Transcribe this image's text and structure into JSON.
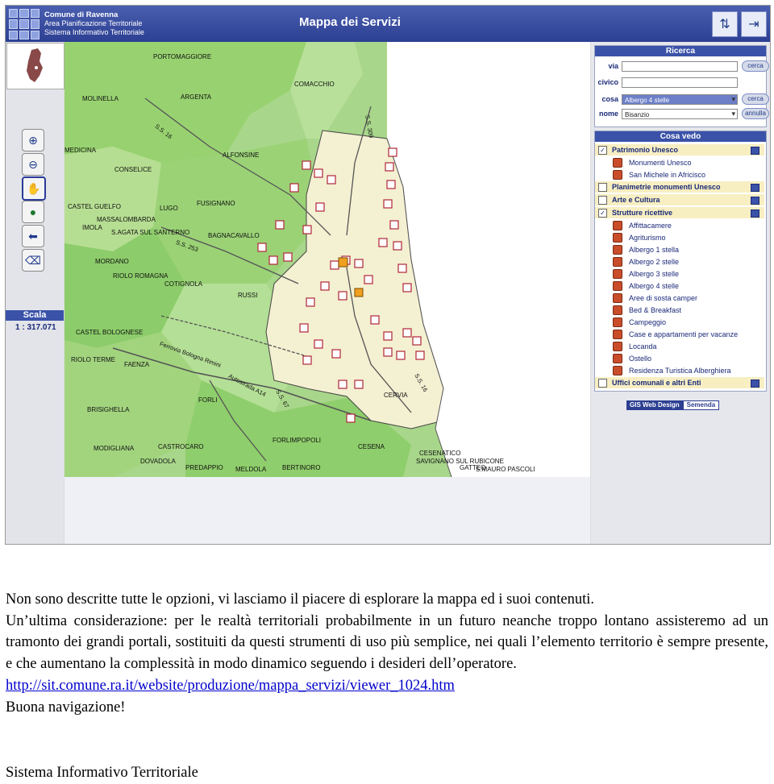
{
  "header": {
    "org_line1": "Comune di Ravenna",
    "org_line2": "Area Pianificazione Territoriale",
    "org_line3": "Sistema Informativo Territoriale",
    "title": "Mappa dei Servizi"
  },
  "toolbar": {
    "tools": [
      "zoom-in-icon",
      "zoom-out-icon",
      "pan-hand-icon",
      "globe-icon",
      "back-arrow-icon",
      "eraser-icon"
    ]
  },
  "scale": {
    "label": "Scala",
    "value": "1 : 317.071"
  },
  "map_labels": [
    "PORTOMAGGIORE",
    "COMACCHIO",
    "MOLINELLA",
    "ARGENTA",
    "MEDICINA",
    "ALFONSINE",
    "CONSELICE",
    "CASTEL GUELFO",
    "MASSALOMBARDA",
    "LUGO",
    "FUSIGNANO",
    "IMOLA",
    "S.AGATA SUL SANTERNO",
    "BAGNACAVALLO",
    "MORDANO",
    "RIOLO ROMAGNA",
    "COTIGNOLA",
    "RUSSI",
    "CASTEL BOLOGNESE",
    "RIOLO TERME",
    "FAENZA",
    "FORLI",
    "BRISIGHELLA",
    "CERVIA",
    "MODIGLIANA",
    "CASTROCARO",
    "FORLIMPOPOLI",
    "DOVADOLA",
    "CESENA",
    "PREDAPPIO",
    "MELDOLA",
    "BERTINORO",
    "CESENATICO",
    "SAVIGNANO SUL RUBICONE",
    "GATTEO",
    "S.MAURO PASCOLI"
  ],
  "road_labels": [
    "S.S. 16",
    "S.S. 309",
    "S.S. 253",
    "Autostrada A14",
    "Ferrovia Bologna Rimini",
    "S.S. 67",
    "S.S. 16"
  ],
  "search": {
    "title": "Ricerca",
    "via_label": "via",
    "civico_label": "civico",
    "cosa_label": "cosa",
    "nome_label": "nome",
    "cosa_value": "Albergo 4 stelle",
    "nome_value": "Bisanzio",
    "cerca_label": "cerca",
    "annulla_label": "annulla"
  },
  "cosa_vedo": {
    "title": "Cosa vedo",
    "categories": [
      {
        "label": "Patrimonio Unesco",
        "checked": "✓"
      },
      {
        "label": "Planimetrie monumenti Unesco",
        "checked": ""
      },
      {
        "label": "Arte e Cultura",
        "checked": ""
      },
      {
        "label": "Strutture ricettive",
        "checked": "✓"
      },
      {
        "label": "Uffici comunali e altri Enti",
        "checked": ""
      }
    ],
    "unesco_items": [
      "Monumenti Unesco",
      "San Michele in Africisco"
    ],
    "ricettive_items": [
      "Affittacamere",
      "Agriturismo",
      "Albergo 1 stella",
      "Albergo 2 stelle",
      "Albergo 3 stelle",
      "Albergo 4 stelle",
      "Aree di sosta camper",
      "Bed & Breakfast",
      "Campeggio",
      "Case e appartamenti per vacanze",
      "Locanda",
      "Ostello",
      "Residenza Turistica Alberghiera"
    ]
  },
  "credits": {
    "part1": "GIS Web Design",
    "part2": "Semenda"
  },
  "doc": {
    "p1": "Non sono descritte tutte le opzioni, vi lasciamo il piacere di esplorare la mappa ed i suoi contenuti.",
    "p2": "Un’ultima  considerazione: per le realtà territoriali probabilmente in un futuro neanche troppo lontano assisteremo ad un tramonto dei grandi portali, sostituiti da questi strumenti di uso più semplice, nei quali l’elemento territorio è sempre presente, e che aumentano la complessità in modo dinamico seguendo i desideri dell’operatore.",
    "link": "http://sit.comune.ra.it/website/produzione/mappa_servizi/viewer_1024.htm",
    "bye": "Buona navigazione!",
    "footer": "Sistema Informativo Territoriale"
  }
}
